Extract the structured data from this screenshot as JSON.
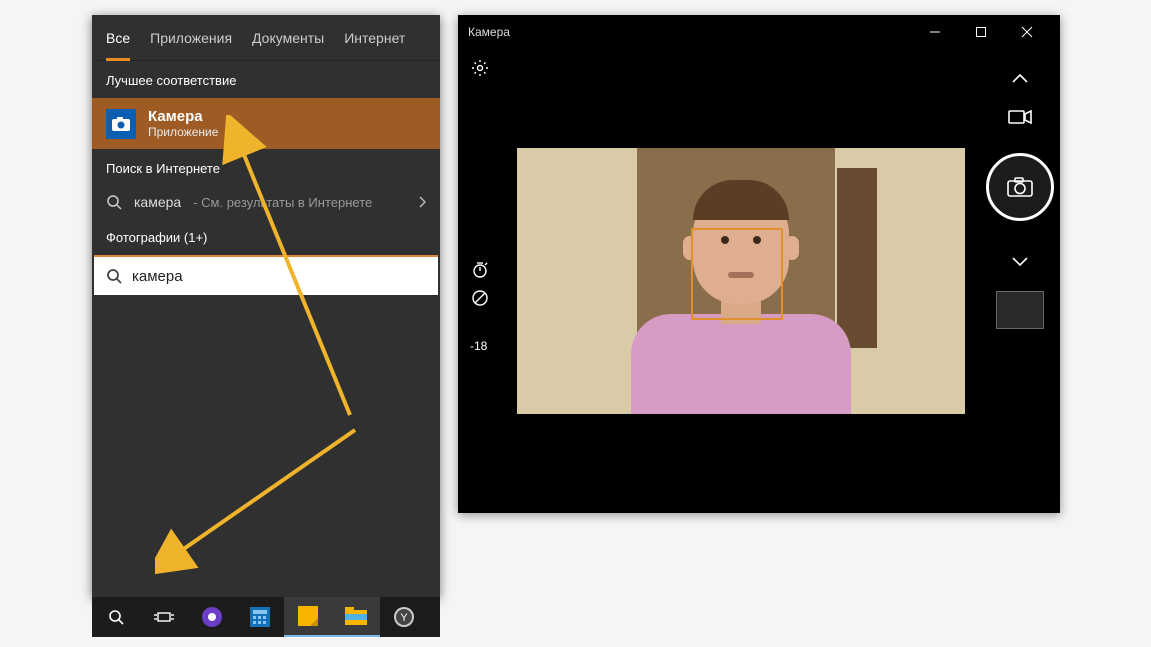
{
  "search": {
    "tabs": [
      "Все",
      "Приложения",
      "Документы",
      "Интернет"
    ],
    "best_match_header": "Лучшее соответствие",
    "best_match": {
      "title": "Камера",
      "subtitle": "Приложение"
    },
    "web_header": "Поиск в Интернете",
    "web_row": {
      "term": "камера",
      "hint": "- См. результаты в Интернете"
    },
    "photos_header": "Фотографии (1+)",
    "input_value": "камера"
  },
  "camera": {
    "title": "Камера",
    "brightness_value": "-18",
    "icons": {
      "settings": "gear-icon",
      "timer": "timer-icon",
      "compensation": "gauge-icon",
      "video_mode": "video-icon",
      "photo_mode": "camera-icon",
      "chevron_up": "chevron-up-icon",
      "chevron_down": "chevron-down-icon"
    }
  },
  "taskbar": {
    "items": [
      "search",
      "task-view",
      "yandex-browser",
      "calculator",
      "sticky-notes",
      "file-explorer",
      "browser"
    ]
  }
}
